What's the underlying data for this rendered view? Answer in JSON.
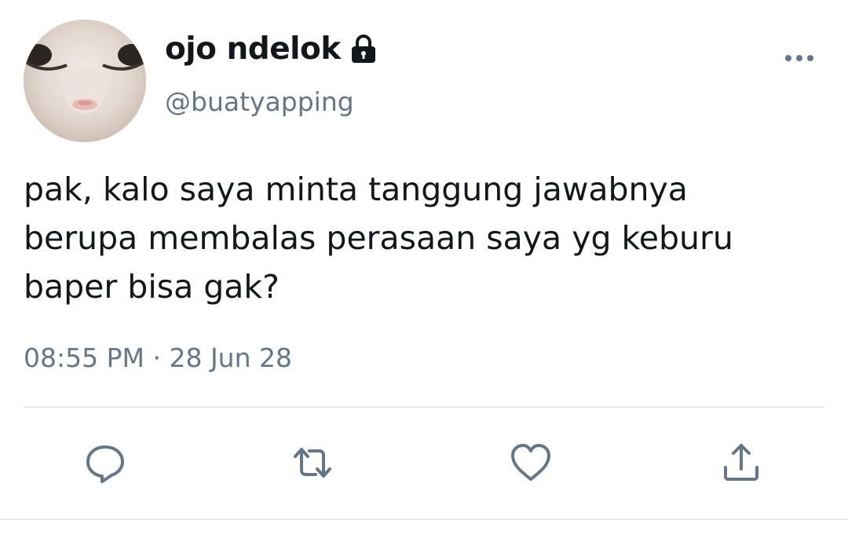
{
  "user": {
    "display_name": "ojo ndelok",
    "handle": "@buatyapping",
    "protected_icon": "lock-icon"
  },
  "tweet": {
    "text": "pak, kalo saya minta tanggung jawabnya\nberupa membalas perasaan saya yg keburu\nbaper bisa gak?",
    "time": "08:55 PM",
    "separator": "·",
    "date": "28 Jun 28"
  },
  "actions": {
    "reply_icon": "speech-bubble-icon",
    "retweet_icon": "retweet-arrows-icon",
    "like_icon": "heart-icon",
    "share_icon": "share-upload-icon",
    "more_icon": "ellipsis-icon"
  },
  "colors": {
    "text_primary": "#14171a",
    "text_secondary": "#657786",
    "icon": "#657786",
    "divider": "#e6ecf0"
  }
}
